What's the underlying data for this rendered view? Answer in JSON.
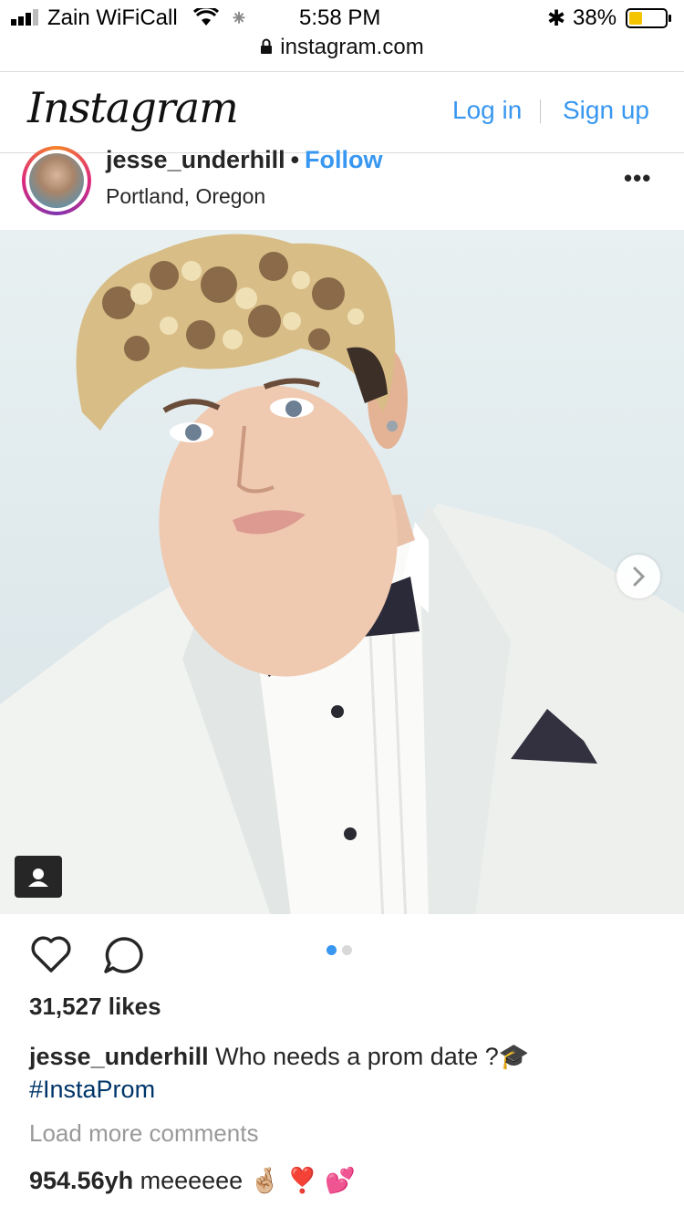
{
  "status_bar": {
    "carrier": "Zain WiFiCall",
    "time": "5:58 PM",
    "battery": "38%",
    "battery_level": 0.38
  },
  "browser": {
    "url": "instagram.com"
  },
  "header": {
    "logo": "Instagram",
    "login_label": "Log in",
    "signup_label": "Sign up"
  },
  "post": {
    "username": "jesse_underhill",
    "follow_label": "Follow",
    "location": "Portland, Oregon",
    "carousel": {
      "current": 1,
      "total": 2
    },
    "likes": "31,527 likes",
    "caption_user": "jesse_underhill",
    "caption_text": "Who needs a prom date ?🎓",
    "hashtag": "#InstaProm",
    "load_more": "Load more comments",
    "comments": [
      {
        "user": "954.56yh",
        "text": "meeeeee 🤞🏼 ❣️ 💕"
      },
      {
        "user": "",
        "text": ""
      }
    ]
  },
  "colors": {
    "link_blue": "#3897f0",
    "hashtag": "#003569",
    "text": "#262626"
  }
}
